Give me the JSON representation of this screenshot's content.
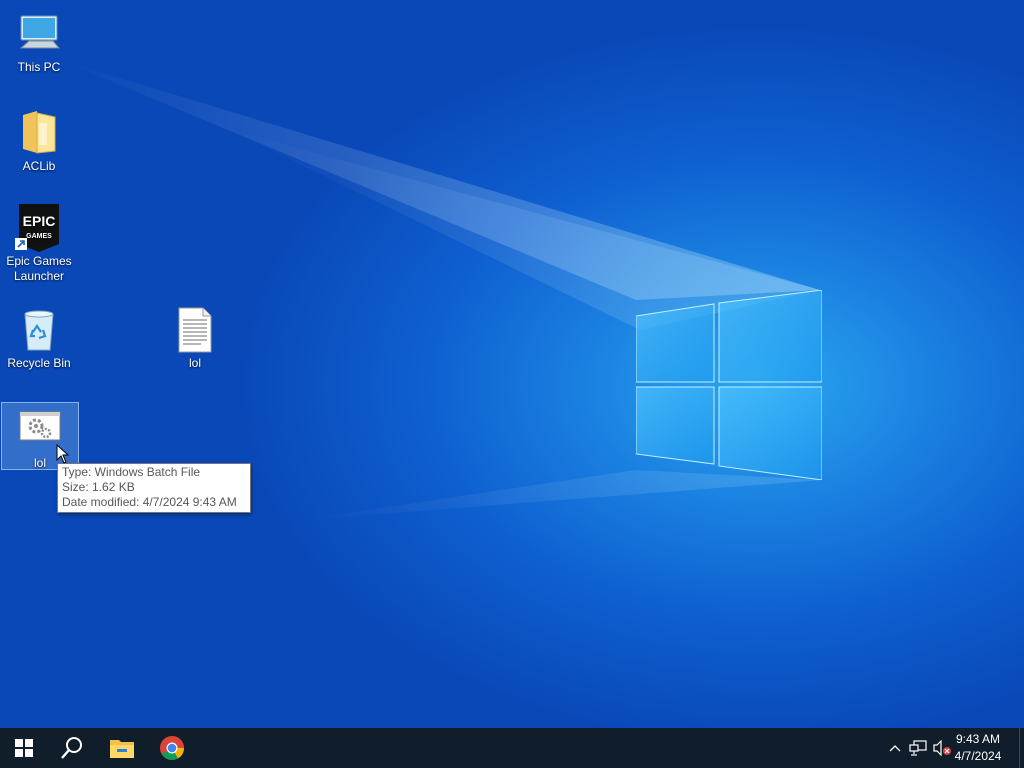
{
  "desktop": {
    "icons": [
      {
        "label": "This PC",
        "icon": "this-pc-icon"
      },
      {
        "label": "ACLib",
        "icon": "folder-icon"
      },
      {
        "label": "Epic Games Launcher",
        "icon": "epic-games-icon"
      },
      {
        "label": "Recycle Bin",
        "icon": "recycle-bin-icon"
      },
      {
        "label": "lol",
        "icon": "text-file-icon"
      },
      {
        "label": "lol",
        "icon": "batch-file-icon",
        "selected": true
      }
    ],
    "tooltip": {
      "type_line": "Type: Windows Batch File",
      "size_line": "Size: 1.62 KB",
      "date_line": "Date modified: 4/7/2024 9:43 AM"
    }
  },
  "taskbar": {
    "buttons": [
      {
        "icon": "windows-start-icon"
      },
      {
        "icon": "search-icon"
      },
      {
        "icon": "file-explorer-icon"
      },
      {
        "icon": "chrome-icon"
      }
    ],
    "tray": {
      "icons": [
        "chevron-up-icon",
        "network-icon",
        "volume-muted-icon"
      ],
      "time": "9:43 AM",
      "date": "4/7/2024"
    }
  },
  "colors": {
    "taskbar": "#101e2b",
    "desktop_accent": "#0e5fd0"
  }
}
